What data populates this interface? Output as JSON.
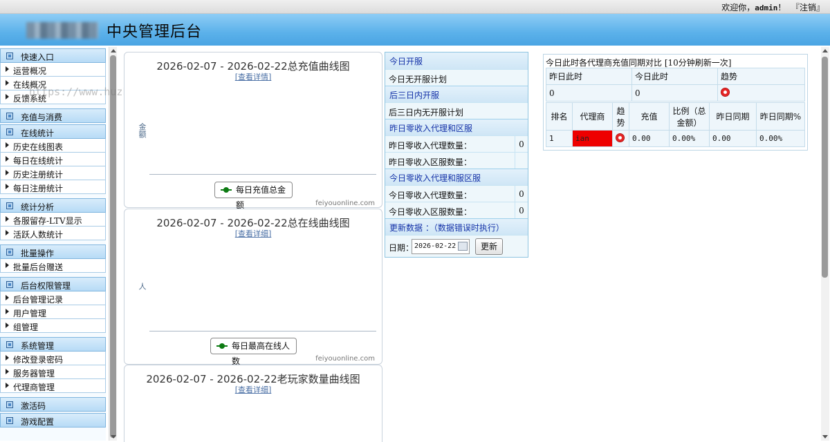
{
  "topbar": {
    "greeting_prefix": "欢迎你，",
    "username": "admin",
    "greeting_suffix": "！",
    "logout": "『注销』"
  },
  "header": {
    "title": "中央管理后台"
  },
  "watermark": "https://www.huzhan.com/ishop39784",
  "sidebar": {
    "groups": [
      {
        "label": "快速入口",
        "items": [
          "运营概况",
          "在线概况",
          "反馈系统"
        ]
      },
      {
        "label": "充值与消费",
        "items": []
      },
      {
        "label": "在线统计",
        "items": [
          "历史在线图表",
          "每日在线统计",
          "历史注册统计",
          "每日注册统计"
        ]
      },
      {
        "label": "统计分析",
        "items": [
          "各服留存-LTV显示",
          "活跃人数统计"
        ]
      },
      {
        "label": "批量操作",
        "items": [
          "批量后台赠送"
        ]
      },
      {
        "label": "后台权限管理",
        "items": [
          "后台管理记录",
          "用户管理",
          "组管理"
        ]
      },
      {
        "label": "系统管理",
        "items": [
          "修改登录密码",
          "服务器管理",
          "代理商管理"
        ]
      },
      {
        "label": "激活码",
        "items": []
      },
      {
        "label": "游戏配置",
        "items": []
      }
    ]
  },
  "charts": [
    {
      "title": "2026-02-07 - 2026-02-22总充值曲线图",
      "link": "[查看详情]",
      "ylabel": "金额",
      "legend": "每日充值总金额",
      "credit": "feiyouonline.com"
    },
    {
      "title": "2026-02-07 - 2026-02-22总在线曲线图",
      "link": "[查看详细]",
      "ylabel": "人",
      "legend": "每日最高在线人数",
      "credit": "feiyouonline.com"
    },
    {
      "title": "2026-02-07 - 2026-02-22老玩家数量曲线图",
      "link": "[查看详细]"
    }
  ],
  "middle": {
    "today_open": {
      "header": "今日开服",
      "text": "今日无开服计划"
    },
    "three_days": {
      "header": "后三日内开服",
      "text": "后三日内无开服计划"
    },
    "yesterday_zero": {
      "header": "昨日零收入代理和区服",
      "agent_label": "昨日零收入代理数量：",
      "agent_value": "0",
      "server_label": "昨日零收入区服数量：",
      "server_value": ""
    },
    "today_zero": {
      "header": "今日零收入代理和服区服",
      "agent_label": "今日零收入代理数量：",
      "agent_value": "0",
      "server_label": "今日零收入区服数量：",
      "server_value": "0"
    },
    "update": {
      "header": "更新数据 ：（数据错误时执行）",
      "date_label": "日期：",
      "date_value": "2026-02-22",
      "button": "更新"
    }
  },
  "right": {
    "title": "今日此时各代理商充值同期对比 [10分钟刷新一次]",
    "summary_headers": [
      "昨日此时",
      "今日此时",
      "趋势"
    ],
    "summary_values": [
      "0",
      "0"
    ],
    "headers": [
      "排名",
      "代理商",
      "趋势",
      "充值",
      "比例（总金额）",
      "昨日同期",
      "昨日同期%"
    ],
    "rows": [
      {
        "rank": "1",
        "agent": "ian",
        "recharge": "0.00",
        "ratio": "0.00%",
        "yesterday": "0.00",
        "yesterday_pct": "0.00%"
      }
    ],
    "highlight_color": "#ee0000"
  }
}
